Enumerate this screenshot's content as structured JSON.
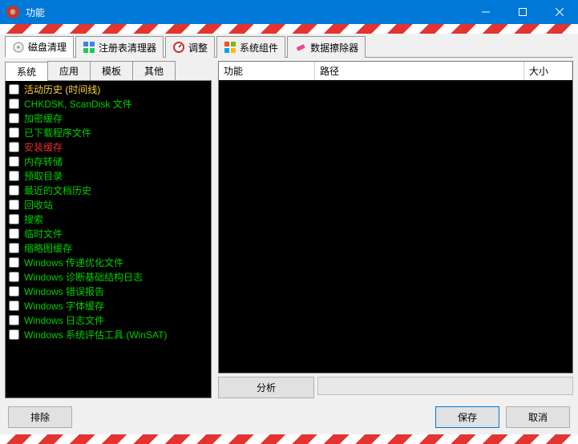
{
  "window": {
    "title": "功能"
  },
  "mainTabs": [
    {
      "label": "磁盘清理"
    },
    {
      "label": "注册表清理器"
    },
    {
      "label": "调整"
    },
    {
      "label": "系统组件"
    },
    {
      "label": "数据擦除器"
    }
  ],
  "subTabs": [
    {
      "label": "系统"
    },
    {
      "label": "应用"
    },
    {
      "label": "模板"
    },
    {
      "label": "其他"
    }
  ],
  "items": [
    {
      "label": "活动历史 (时间线)",
      "color": "#ffd24a"
    },
    {
      "label": "CHKDSK, ScanDisk 文件",
      "color": "#00d000"
    },
    {
      "label": "加密缓存",
      "color": "#00d000"
    },
    {
      "label": "已下载程序文件",
      "color": "#00d000"
    },
    {
      "label": "安装缓存",
      "color": "#e03030"
    },
    {
      "label": "内存转储",
      "color": "#00d000"
    },
    {
      "label": "预取目录",
      "color": "#00d000"
    },
    {
      "label": "最近的文档历史",
      "color": "#00d000"
    },
    {
      "label": "回收站",
      "color": "#00d000"
    },
    {
      "label": "搜索",
      "color": "#00d000"
    },
    {
      "label": "临时文件",
      "color": "#00d000"
    },
    {
      "label": "缩略图缓存",
      "color": "#00d000"
    },
    {
      "label": "Windows 传递优化文件",
      "color": "#00d000"
    },
    {
      "label": "Windows 诊断基础结构日志",
      "color": "#00d000"
    },
    {
      "label": "Windows 错误报告",
      "color": "#00d000"
    },
    {
      "label": "Windows 字体缓存",
      "color": "#00d000"
    },
    {
      "label": "Windows 日志文件",
      "color": "#00d000"
    },
    {
      "label": "Windows 系统评估工具 (WinSAT)",
      "color": "#00d000"
    }
  ],
  "tableHeaders": {
    "func": "功能",
    "path": "路径",
    "size": "大小"
  },
  "buttons": {
    "analyze": "分析",
    "exclude": "排除",
    "save": "保存",
    "cancel": "取消"
  }
}
